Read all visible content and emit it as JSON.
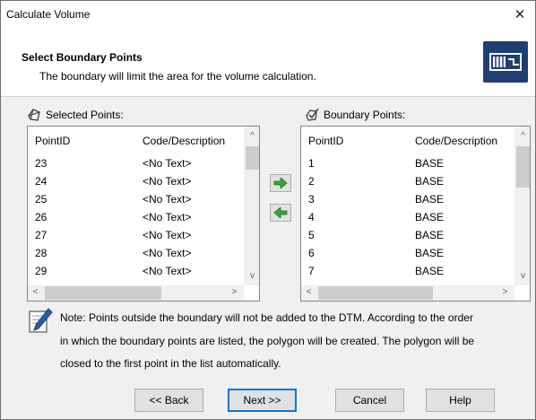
{
  "window": {
    "title": "Calculate Volume",
    "close_glyph": "✕"
  },
  "header": {
    "title": "Select Boundary Points",
    "subtitle": "The boundary will limit the area for the volume calculation.",
    "icon": "boundary-icon",
    "icon_color": "#1f3f73"
  },
  "selected": {
    "label": "Selected Points:",
    "icon": "polygon-icon",
    "columns": [
      "PointID",
      "Code/Description"
    ],
    "rows": [
      [
        "23",
        "<No Text>"
      ],
      [
        "24",
        "<No Text>"
      ],
      [
        "25",
        "<No Text>"
      ],
      [
        "26",
        "<No Text>"
      ],
      [
        "27",
        "<No Text>"
      ],
      [
        "28",
        "<No Text>"
      ],
      [
        "29",
        "<No Text>"
      ]
    ]
  },
  "boundary": {
    "label": "Boundary Points:",
    "icon": "polygon-check-icon",
    "columns": [
      "PointID",
      "Code/Description"
    ],
    "rows": [
      [
        "1",
        "BASE"
      ],
      [
        "2",
        "BASE"
      ],
      [
        "3",
        "BASE"
      ],
      [
        "4",
        "BASE"
      ],
      [
        "5",
        "BASE"
      ],
      [
        "6",
        "BASE"
      ],
      [
        "7",
        "BASE"
      ]
    ]
  },
  "move": {
    "add_icon": "arrow-right-icon",
    "remove_icon": "arrow-left-icon",
    "arrow_color": "#3aa63a"
  },
  "note": {
    "icon": "note-pencil-icon",
    "lines": [
      "Note: Points outside the boundary will not be added to the DTM. According to the order",
      "in which the boundary points are listed, the polygon will be created. The polygon will be",
      "closed to the first point in the list automatically."
    ]
  },
  "buttons": {
    "back": {
      "label": "<< Back",
      "mnemonic": "B"
    },
    "next": {
      "label": "Next >>",
      "mnemonic": "N"
    },
    "cancel": {
      "label": "Cancel",
      "mnemonic": "C"
    },
    "help": {
      "label": "Help",
      "mnemonic": "H"
    }
  },
  "scroll_glyphs": {
    "up": "^",
    "down": "v",
    "left": "<",
    "right": ">"
  }
}
